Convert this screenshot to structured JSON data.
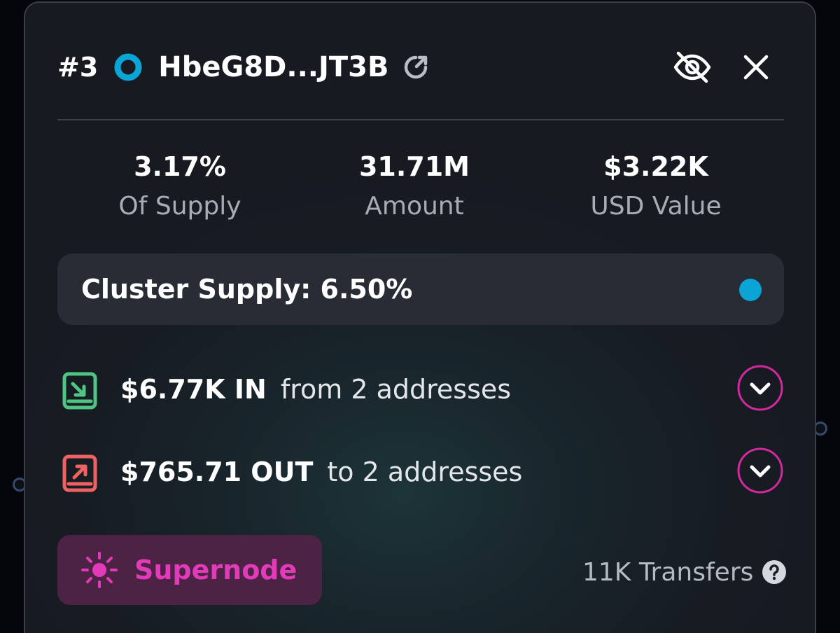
{
  "header": {
    "rank": "#3",
    "address": "HbeG8D...JT3B",
    "address_dot_color": "#0aa5d6",
    "icons": [
      "external-link-icon",
      "eye-off-icon",
      "close-icon"
    ]
  },
  "stats": [
    {
      "value": "3.17%",
      "label": "Of Supply"
    },
    {
      "value": "31.71M",
      "label": "Amount"
    },
    {
      "value": "$3.22K",
      "label": "USD Value"
    }
  ],
  "cluster": {
    "text": "Cluster Supply: 6.50%",
    "dot_color": "#0aa5d6"
  },
  "flows": {
    "in": {
      "amount": "$6.77K IN",
      "description": "from 2 addresses",
      "icon": "receive-icon",
      "color": "#4fc483"
    },
    "out": {
      "amount": "$765.71 OUT",
      "description": "to 2 addresses",
      "icon": "send-icon",
      "color": "#ef6262"
    }
  },
  "footer": {
    "supernode_label": "Supernode",
    "supernode_color": "#e23ab8",
    "transfers_text": "11K Transfers"
  }
}
